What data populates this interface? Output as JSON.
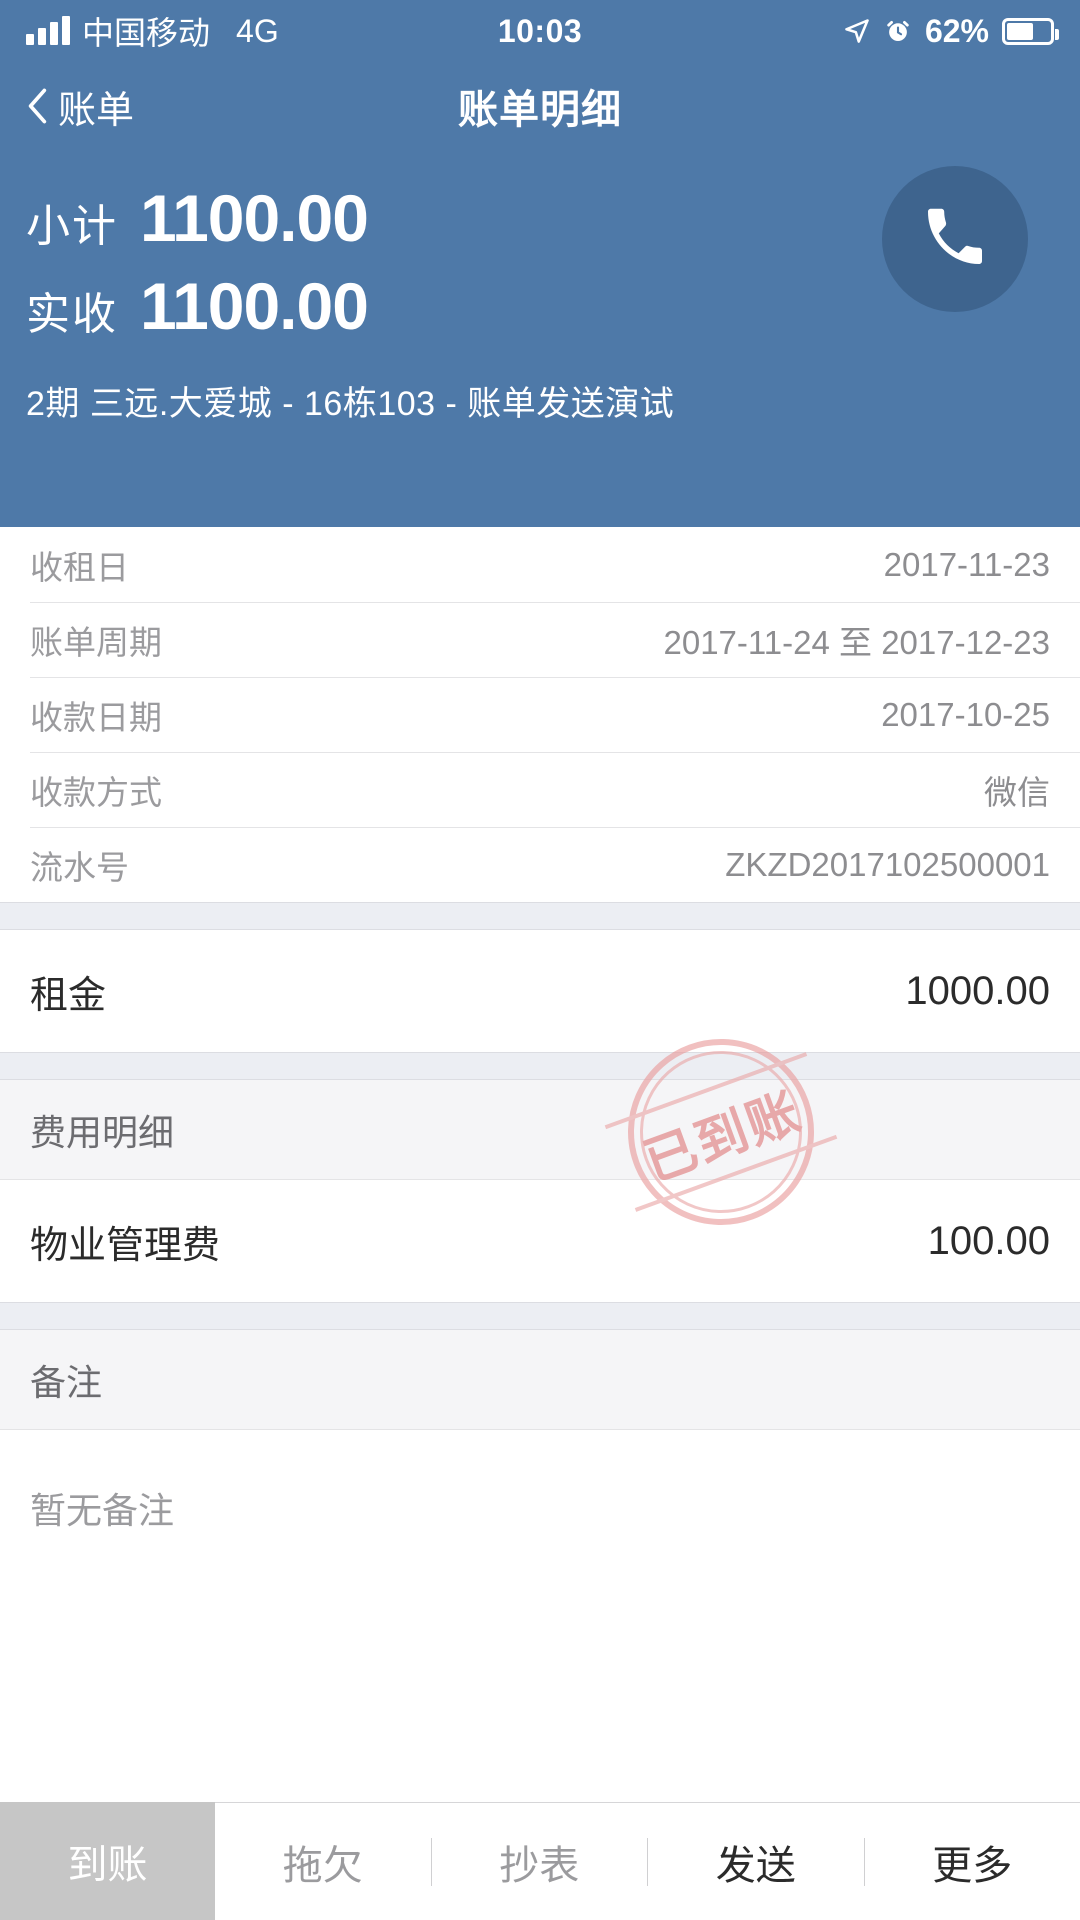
{
  "status_bar": {
    "carrier": "中国移动",
    "network": "4G",
    "time": "10:03",
    "battery_percent": "62%",
    "icons": [
      "signal-bars-icon",
      "location-arrow-icon",
      "alarm-clock-icon",
      "battery-icon"
    ]
  },
  "nav": {
    "back_label": "账单",
    "title": "账单明细",
    "call_icon": "phone-icon"
  },
  "summary": {
    "subtotal_label": "小计",
    "subtotal_value": "1100.00",
    "received_label": "实收",
    "received_value": "1100.00",
    "address": "2期 三远.大爱城 - 16栋103 - 账单发送演试"
  },
  "stamp": {
    "text": "已到账",
    "color": "#e07a7a"
  },
  "info_rows": [
    {
      "key": "收租日",
      "value": "2017-11-23"
    },
    {
      "key": "账单周期",
      "value": "2017-11-24 至 2017-12-23"
    },
    {
      "key": "收款日期",
      "value": "2017-10-25"
    },
    {
      "key": "收款方式",
      "value": "微信"
    },
    {
      "key": "流水号",
      "value": "ZKZD2017102500001"
    }
  ],
  "rent": {
    "label": "租金",
    "value": "1000.00"
  },
  "fee_section": {
    "title": "费用明细",
    "rows": [
      {
        "label": "物业管理费",
        "value": "100.00"
      }
    ]
  },
  "remark_section": {
    "title": "备注",
    "empty_text": "暂无备注"
  },
  "toolbar": {
    "primary": "到账",
    "items": [
      "拖欠",
      "抄表",
      "发送",
      "更多"
    ]
  },
  "colors": {
    "header_blue": "#4e79a8",
    "call_button": "#3e648e",
    "stamp_red": "#e07a7a",
    "section_gray": "#f5f5f7",
    "divider": "#e4e4e6"
  }
}
